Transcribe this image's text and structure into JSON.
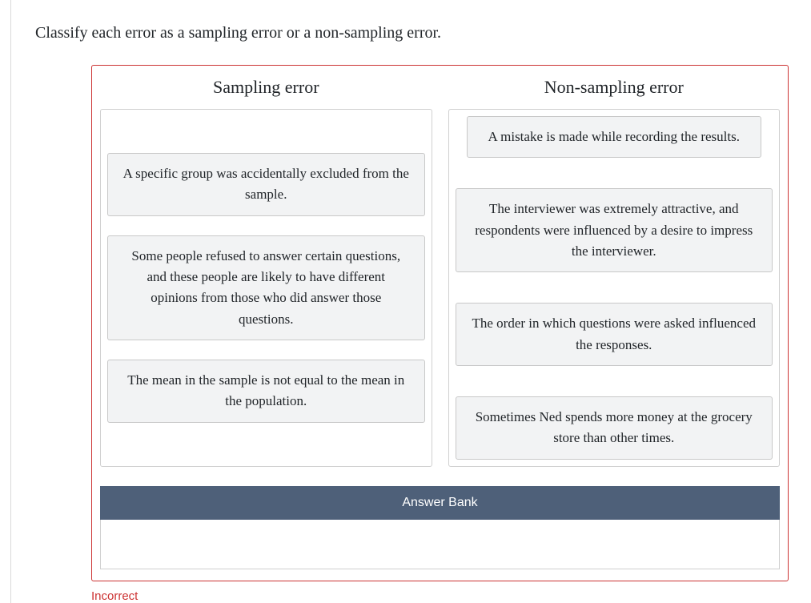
{
  "prompt": "Classify each error as a sampling error or a non-sampling error.",
  "columns": {
    "left": {
      "title": "Sampling error",
      "items": [
        "A specific group was accidentally excluded from the sample.",
        "Some people refused to answer certain questions, and these people are likely to have different opinions from those who did answer those questions.",
        "The mean in the sample is not equal to the mean in the population."
      ]
    },
    "right": {
      "title": "Non-sampling error",
      "items": [
        "A mistake is made while recording the results.",
        "The interviewer was extremely attractive, and respondents were influenced by a desire to impress the interviewer.",
        "The order in which questions were asked influenced the responses.",
        "Sometimes Ned spends more money at the grocery store than other times."
      ]
    }
  },
  "bank": {
    "title": "Answer Bank"
  },
  "feedback": "Incorrect"
}
